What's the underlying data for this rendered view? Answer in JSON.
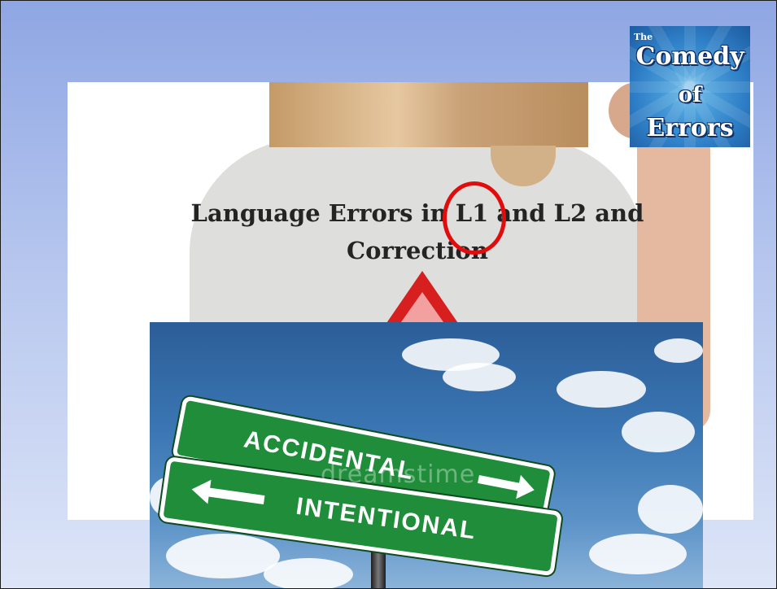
{
  "shirt_photo": {
    "title_line1": "Language Errors in L1 and L2 and",
    "title_line2": "Correction"
  },
  "logo": {
    "small": "The",
    "word1": "Comedy",
    "word2": "of",
    "word3": "Errors"
  },
  "sign_photo": {
    "top_sign": "ACCIDENTAL",
    "bottom_sign": "INTENTIONAL",
    "watermark": "dreamstime"
  },
  "colors": {
    "slide_bg_top": "#8ea6e3",
    "sign_green": "#1f8d3a",
    "circle_red": "#e10d0d"
  }
}
